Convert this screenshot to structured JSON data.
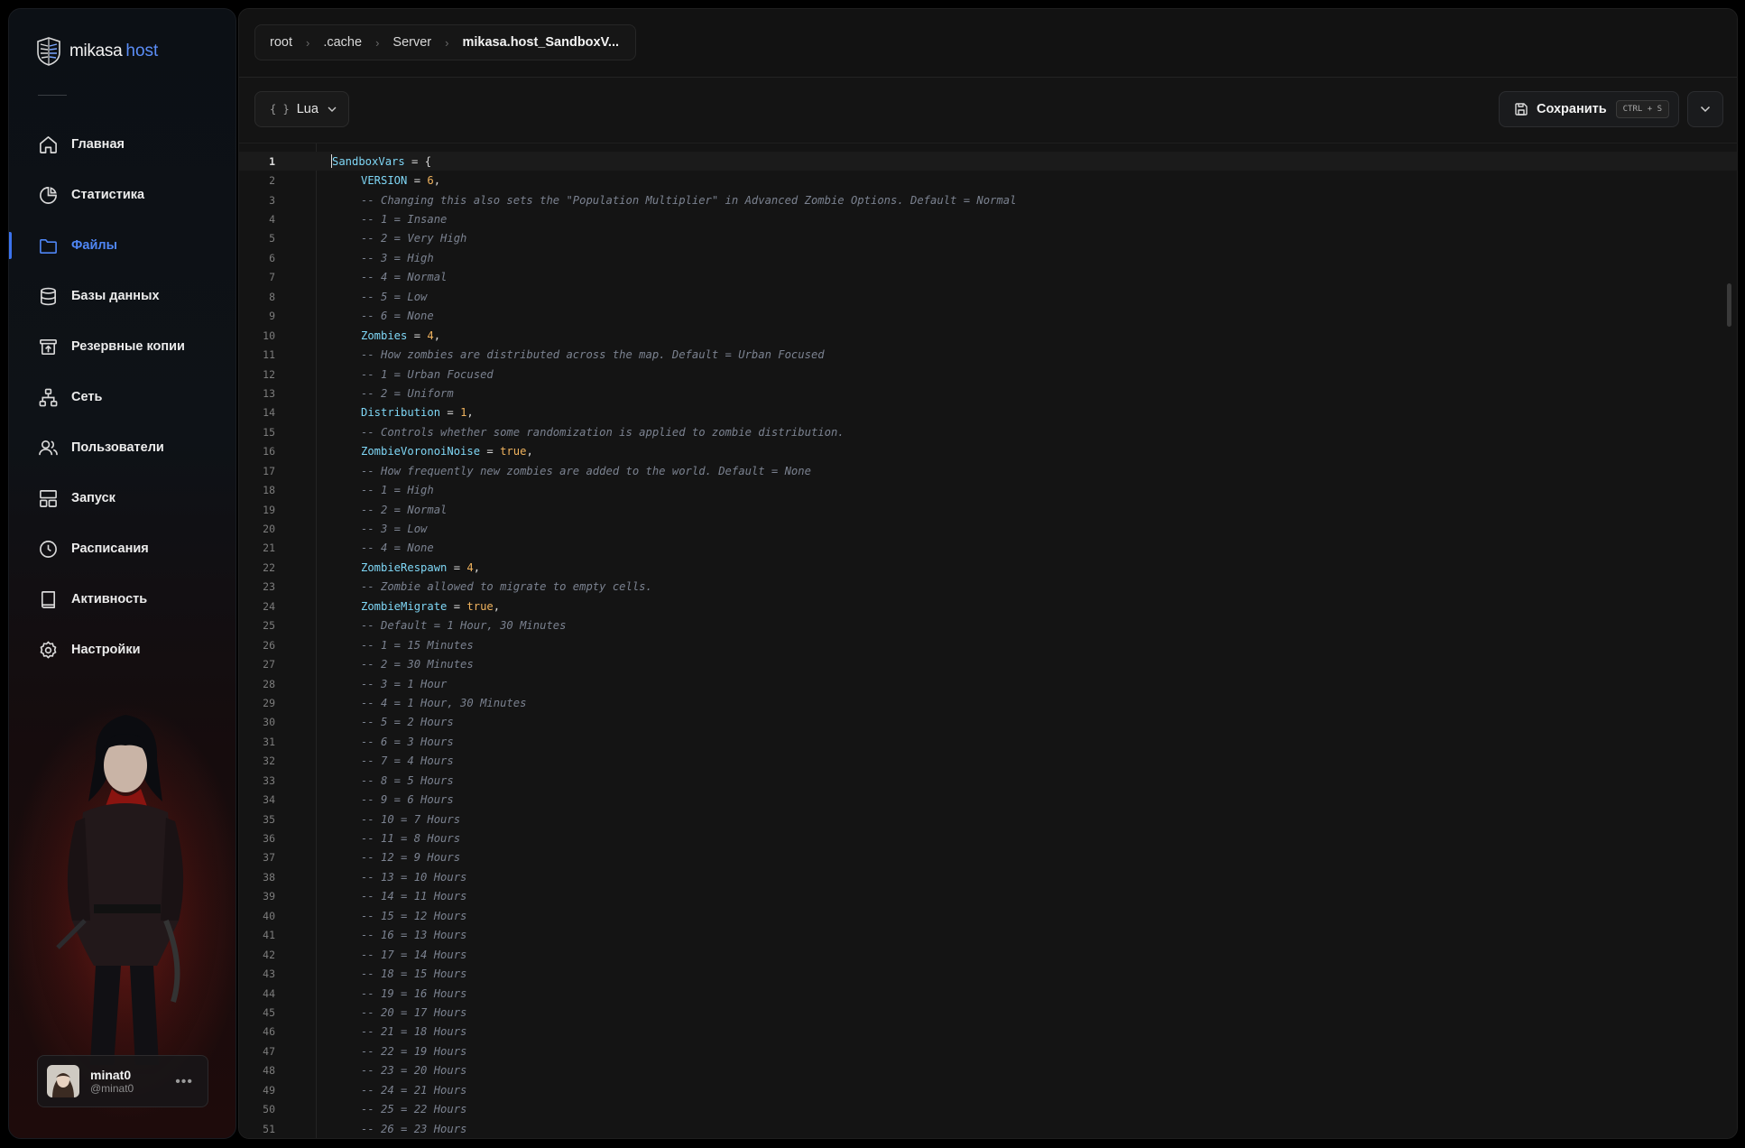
{
  "brand": {
    "name": "mikasa",
    "suffix": "host"
  },
  "sidebar": {
    "items": [
      {
        "label": "Главная",
        "icon": "home-icon"
      },
      {
        "label": "Статистика",
        "icon": "pie-chart-icon"
      },
      {
        "label": "Файлы",
        "icon": "folder-icon",
        "active": true
      },
      {
        "label": "Базы данных",
        "icon": "database-icon"
      },
      {
        "label": "Резервные копии",
        "icon": "backup-icon"
      },
      {
        "label": "Сеть",
        "icon": "network-icon"
      },
      {
        "label": "Пользователи",
        "icon": "users-icon"
      },
      {
        "label": "Запуск",
        "icon": "layout-icon"
      },
      {
        "label": "Расписания",
        "icon": "clock-icon"
      },
      {
        "label": "Активность",
        "icon": "book-icon"
      },
      {
        "label": "Настройки",
        "icon": "gear-icon"
      }
    ]
  },
  "user": {
    "name": "minat0",
    "handle": "@minat0"
  },
  "breadcrumb": [
    "root",
    ".cache",
    "Server",
    "mikasa.host_SandboxV..."
  ],
  "toolbar": {
    "language": "Lua",
    "save_label": "Сохранить",
    "save_shortcut": "CTRL + S"
  },
  "colors": {
    "accent": "#4f86f5",
    "key": "#7fd7f6",
    "number": "#f0b35e",
    "comment": "#7b8290"
  },
  "editor": {
    "lines": [
      [
        {
          "t": "SandboxVars",
          "c": "key"
        },
        {
          "t": " = {",
          "c": "op"
        }
      ],
      [
        {
          "t": "VERSION",
          "c": "key"
        },
        {
          "t": " = ",
          "c": "op"
        },
        {
          "t": "6",
          "c": "num"
        },
        {
          "t": ",",
          "c": "op"
        }
      ],
      [
        {
          "t": "-- Changing this also sets the \"Population Multiplier\" in Advanced Zombie Options. Default = Normal",
          "c": "com"
        }
      ],
      [
        {
          "t": "-- 1 = Insane",
          "c": "com"
        }
      ],
      [
        {
          "t": "-- 2 = Very High",
          "c": "com"
        }
      ],
      [
        {
          "t": "-- 3 = High",
          "c": "com"
        }
      ],
      [
        {
          "t": "-- 4 = Normal",
          "c": "com"
        }
      ],
      [
        {
          "t": "-- 5 = Low",
          "c": "com"
        }
      ],
      [
        {
          "t": "-- 6 = None",
          "c": "com"
        }
      ],
      [
        {
          "t": "Zombies",
          "c": "key"
        },
        {
          "t": " = ",
          "c": "op"
        },
        {
          "t": "4",
          "c": "num"
        },
        {
          "t": ",",
          "c": "op"
        }
      ],
      [
        {
          "t": "-- How zombies are distributed across the map. Default = Urban Focused",
          "c": "com"
        }
      ],
      [
        {
          "t": "-- 1 = Urban Focused",
          "c": "com"
        }
      ],
      [
        {
          "t": "-- 2 = Uniform",
          "c": "com"
        }
      ],
      [
        {
          "t": "Distribution",
          "c": "key"
        },
        {
          "t": " = ",
          "c": "op"
        },
        {
          "t": "1",
          "c": "num"
        },
        {
          "t": ",",
          "c": "op"
        }
      ],
      [
        {
          "t": "-- Controls whether some randomization is applied to zombie distribution.",
          "c": "com"
        }
      ],
      [
        {
          "t": "ZombieVoronoiNoise",
          "c": "key"
        },
        {
          "t": " = ",
          "c": "op"
        },
        {
          "t": "true",
          "c": "bool"
        },
        {
          "t": ",",
          "c": "op"
        }
      ],
      [
        {
          "t": "-- How frequently new zombies are added to the world. Default = None",
          "c": "com"
        }
      ],
      [
        {
          "t": "-- 1 = High",
          "c": "com"
        }
      ],
      [
        {
          "t": "-- 2 = Normal",
          "c": "com"
        }
      ],
      [
        {
          "t": "-- 3 = Low",
          "c": "com"
        }
      ],
      [
        {
          "t": "-- 4 = None",
          "c": "com"
        }
      ],
      [
        {
          "t": "ZombieRespawn",
          "c": "key"
        },
        {
          "t": " = ",
          "c": "op"
        },
        {
          "t": "4",
          "c": "num"
        },
        {
          "t": ",",
          "c": "op"
        }
      ],
      [
        {
          "t": "-- Zombie allowed to migrate to empty cells.",
          "c": "com"
        }
      ],
      [
        {
          "t": "ZombieMigrate",
          "c": "key"
        },
        {
          "t": " = ",
          "c": "op"
        },
        {
          "t": "true",
          "c": "bool"
        },
        {
          "t": ",",
          "c": "op"
        }
      ],
      [
        {
          "t": "-- Default = 1 Hour, 30 Minutes",
          "c": "com"
        }
      ],
      [
        {
          "t": "-- 1 = 15 Minutes",
          "c": "com"
        }
      ],
      [
        {
          "t": "-- 2 = 30 Minutes",
          "c": "com"
        }
      ],
      [
        {
          "t": "-- 3 = 1 Hour",
          "c": "com"
        }
      ],
      [
        {
          "t": "-- 4 = 1 Hour, 30 Minutes",
          "c": "com"
        }
      ],
      [
        {
          "t": "-- 5 = 2 Hours",
          "c": "com"
        }
      ],
      [
        {
          "t": "-- 6 = 3 Hours",
          "c": "com"
        }
      ],
      [
        {
          "t": "-- 7 = 4 Hours",
          "c": "com"
        }
      ],
      [
        {
          "t": "-- 8 = 5 Hours",
          "c": "com"
        }
      ],
      [
        {
          "t": "-- 9 = 6 Hours",
          "c": "com"
        }
      ],
      [
        {
          "t": "-- 10 = 7 Hours",
          "c": "com"
        }
      ],
      [
        {
          "t": "-- 11 = 8 Hours",
          "c": "com"
        }
      ],
      [
        {
          "t": "-- 12 = 9 Hours",
          "c": "com"
        }
      ],
      [
        {
          "t": "-- 13 = 10 Hours",
          "c": "com"
        }
      ],
      [
        {
          "t": "-- 14 = 11 Hours",
          "c": "com"
        }
      ],
      [
        {
          "t": "-- 15 = 12 Hours",
          "c": "com"
        }
      ],
      [
        {
          "t": "-- 16 = 13 Hours",
          "c": "com"
        }
      ],
      [
        {
          "t": "-- 17 = 14 Hours",
          "c": "com"
        }
      ],
      [
        {
          "t": "-- 18 = 15 Hours",
          "c": "com"
        }
      ],
      [
        {
          "t": "-- 19 = 16 Hours",
          "c": "com"
        }
      ],
      [
        {
          "t": "-- 20 = 17 Hours",
          "c": "com"
        }
      ],
      [
        {
          "t": "-- 21 = 18 Hours",
          "c": "com"
        }
      ],
      [
        {
          "t": "-- 22 = 19 Hours",
          "c": "com"
        }
      ],
      [
        {
          "t": "-- 23 = 20 Hours",
          "c": "com"
        }
      ],
      [
        {
          "t": "-- 24 = 21 Hours",
          "c": "com"
        }
      ],
      [
        {
          "t": "-- 25 = 22 Hours",
          "c": "com"
        }
      ],
      [
        {
          "t": "-- 26 = 23 Hours",
          "c": "com"
        }
      ]
    ]
  }
}
